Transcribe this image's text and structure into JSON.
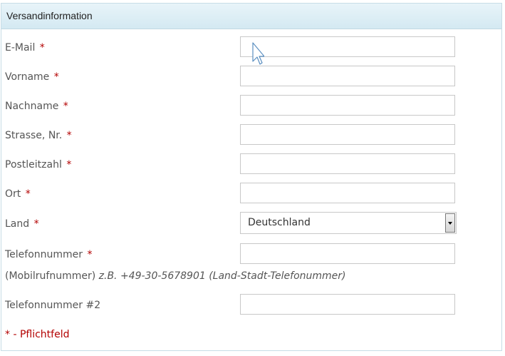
{
  "panel": {
    "title": "Versandinformation"
  },
  "required_marker": "*",
  "fields": {
    "email": {
      "label": "E-Mail",
      "value": ""
    },
    "firstname": {
      "label": "Vorname",
      "value": ""
    },
    "lastname": {
      "label": "Nachname",
      "value": ""
    },
    "street": {
      "label": "Strasse, Nr.",
      "value": ""
    },
    "zip": {
      "label": "Postleitzahl",
      "value": ""
    },
    "city": {
      "label": "Ort",
      "value": ""
    },
    "country": {
      "label": "Land",
      "selected": "Deutschland"
    },
    "phone": {
      "label": "Telefonnummer",
      "value": ""
    },
    "phone2": {
      "label": "Telefonnummer #2",
      "value": ""
    }
  },
  "phone_hint": {
    "prefix": "(Mobilrufnummer) ",
    "example": "z.B. +49-30-5678901 (Land-Stadt-Telefonummer)"
  },
  "legend": "* - Pflichtfeld",
  "colors": {
    "required": "#b30000",
    "header_bg": "#d9ecf5",
    "border": "#c8c8c8"
  },
  "icons": {
    "cursor": "mouse-pointer-icon",
    "dropdown": "chevron-down-icon"
  }
}
